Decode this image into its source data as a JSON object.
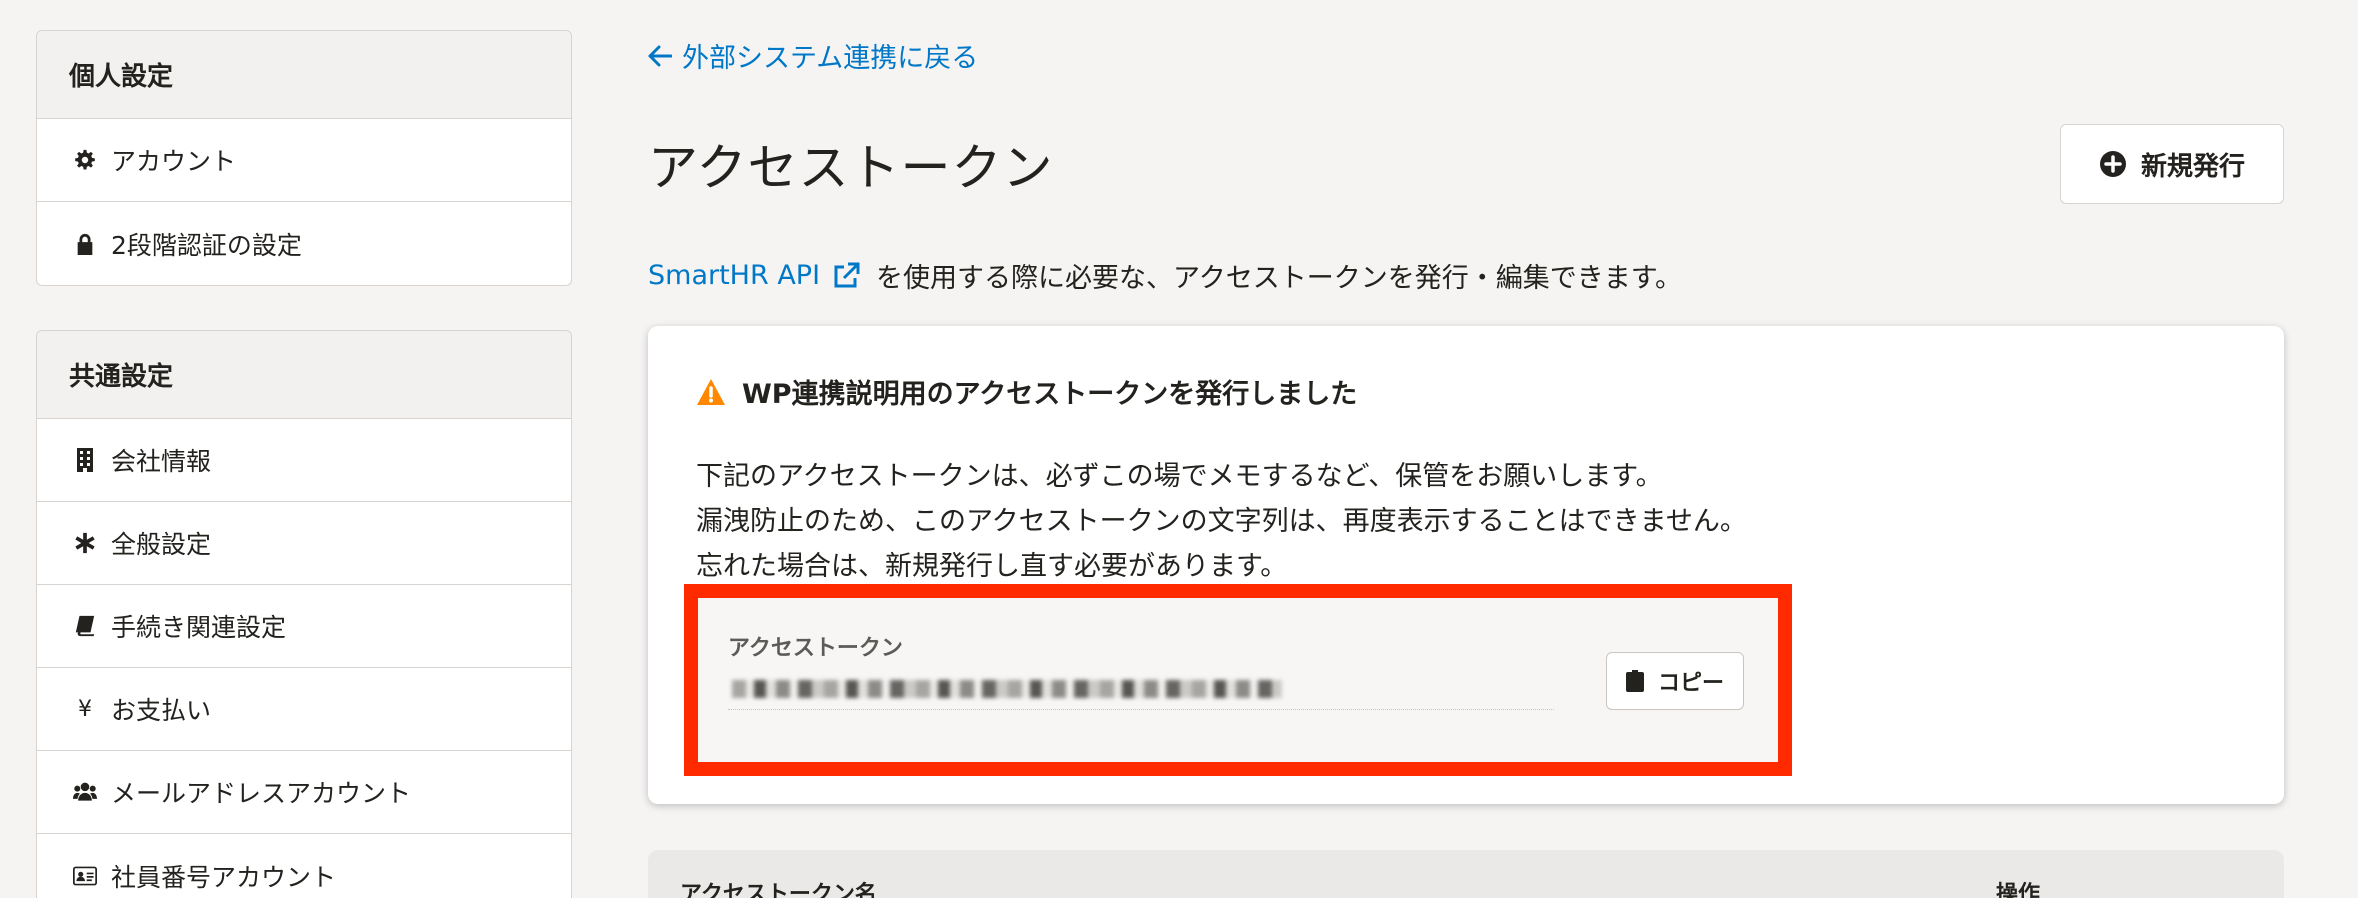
{
  "sidebar": {
    "personal": {
      "title": "個人設定",
      "items": [
        {
          "label": "アカウント",
          "icon": "gear-icon"
        },
        {
          "label": "2段階認証の設定",
          "icon": "lock-icon"
        }
      ]
    },
    "common": {
      "title": "共通設定",
      "items": [
        {
          "label": "会社情報",
          "icon": "building-icon"
        },
        {
          "label": "全般設定",
          "icon": "asterisk-icon"
        },
        {
          "label": "手続き関連設定",
          "icon": "book-icon"
        },
        {
          "label": "お支払い",
          "icon": "yen-icon",
          "glyph": "¥"
        },
        {
          "label": "メールアドレスアカウント",
          "icon": "users-icon"
        },
        {
          "label": "社員番号アカウント",
          "icon": "id-card-icon"
        }
      ]
    }
  },
  "main": {
    "back_link": "外部システム連携に戻る",
    "title": "アクセストークン",
    "new_button": "新規発行",
    "intro": {
      "link": "SmartHR API",
      "text": "を使用する際に必要な、アクセストークンを発行・編集できます。"
    },
    "notice": {
      "title": "WP連携説明用のアクセストークンを発行しました",
      "lines": [
        "下記のアクセストークンは、必ずこの場でメモするなど、保管をお願いします。",
        "漏洩防止のため、このアクセストークンの文字列は、再度表示することはできません。",
        "忘れた場合は、新規発行し直す必要があります。"
      ],
      "token_label": "アクセストークン",
      "copy_button": "コピー"
    },
    "table": {
      "headers": [
        "アクセストークン名",
        "操作"
      ]
    }
  },
  "colors": {
    "link": "#0077c7",
    "highlight": "#ff2a00",
    "warning": "#ff8800"
  }
}
